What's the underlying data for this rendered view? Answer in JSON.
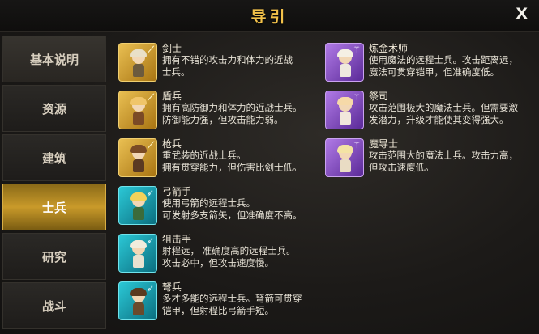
{
  "window": {
    "title": "导引",
    "close_label": "X"
  },
  "sidebar": {
    "tabs": [
      {
        "label": "基本说明",
        "active": false
      },
      {
        "label": "资源",
        "active": false
      },
      {
        "label": "建筑",
        "active": false
      },
      {
        "label": "士兵",
        "active": true
      },
      {
        "label": "研究",
        "active": false
      },
      {
        "label": "战斗",
        "active": false
      }
    ]
  },
  "units_left": [
    {
      "name": "剑士",
      "desc_line1": "拥有不错的攻击力和体力的近战",
      "desc_line2": "士兵。",
      "type_icon": "sword-icon",
      "frame_color": "#d9a635"
    },
    {
      "name": "盾兵",
      "desc_line1": "拥有高防御力和体力的近战士兵。",
      "desc_line2": "防御能力强，但攻击能力弱。",
      "type_icon": "sword-icon",
      "frame_color": "#d9a635"
    },
    {
      "name": "枪兵",
      "desc_line1": "重武装的近战士兵。",
      "desc_line2": "拥有贯穿能力，但伤害比剑士低。",
      "type_icon": "sword-icon",
      "frame_color": "#d9a635"
    },
    {
      "name": "弓箭手",
      "desc_line1": "使用弓箭的远程士兵。",
      "desc_line2": "可发射多支箭矢，但准确度不高。",
      "type_icon": "bow-icon",
      "frame_color": "#1fb3c4"
    },
    {
      "name": "狙击手",
      "desc_line1": "射程远， 准确度高的远程士兵。",
      "desc_line2": "攻击必中，但攻击速度慢。",
      "type_icon": "bow-icon",
      "frame_color": "#1fb3c4"
    },
    {
      "name": "弩兵",
      "desc_line1": "多才多能的远程士兵。弩箭可贯穿",
      "desc_line2": "铠甲，但射程比弓箭手短。",
      "type_icon": "bow-icon",
      "frame_color": "#1fb3c4"
    }
  ],
  "units_right": [
    {
      "name": "炼金术师",
      "desc_line1": "使用魔法的远程士兵。攻击距离远，",
      "desc_line2": "魔法可贯穿铠甲，但准确度低。",
      "type_icon": "staff-icon",
      "frame_color": "#8e55c9"
    },
    {
      "name": "祭司",
      "desc_line1": "攻击范围极大的魔法士兵。但需要激",
      "desc_line2": "发潜力，升级才能使其变得强大。",
      "type_icon": "staff-icon",
      "frame_color": "#8e55c9"
    },
    {
      "name": "魔导士",
      "desc_line1": "攻击范围大的魔法士兵。攻击力高，",
      "desc_line2": "但攻击速度低。",
      "type_icon": "staff-icon",
      "frame_color": "#8e55c9"
    }
  ]
}
